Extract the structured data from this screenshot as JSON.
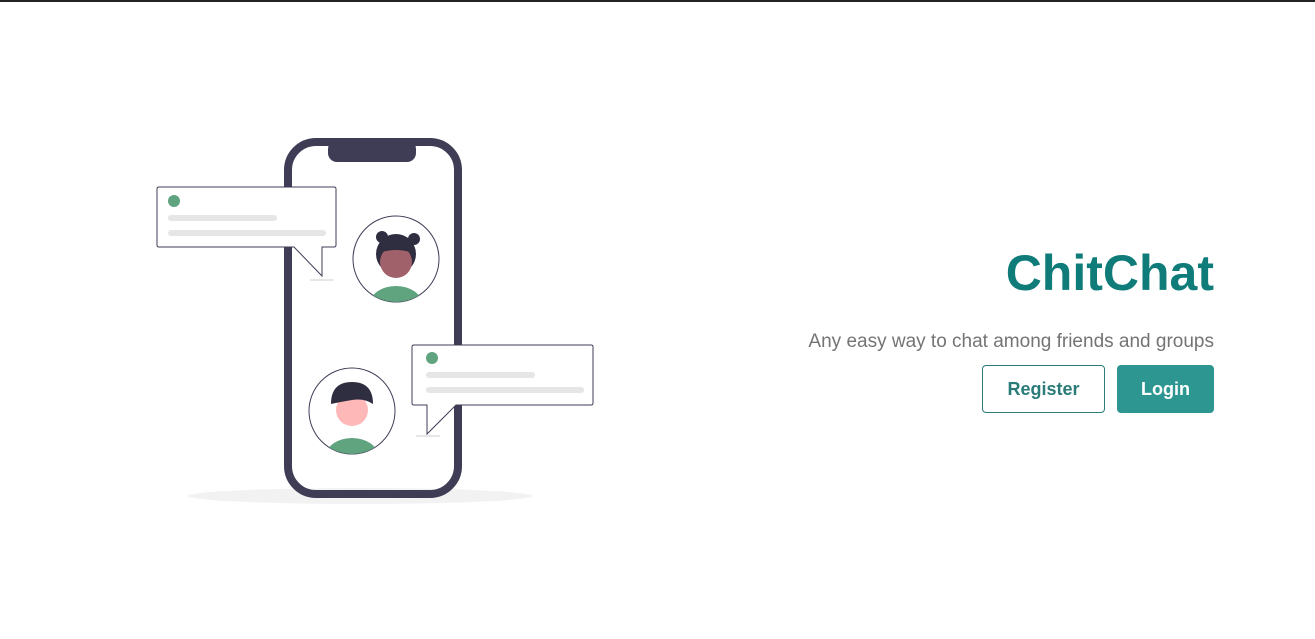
{
  "hero": {
    "title": "ChitChat",
    "tagline": "Any easy way to chat among friends and groups",
    "register_label": "Register",
    "login_label": "Login"
  },
  "illustration": {
    "subject": "phone-with-chat-bubbles",
    "colors": {
      "phone_frame": "#3f3d56",
      "accent_green": "#5fa37f",
      "placeholder_line": "#e6e6e6",
      "skin_dark": "#a0616a",
      "skin_light": "#ffb8b8",
      "hair": "#2f2e41",
      "shadow": "#f2f2f2"
    }
  },
  "theme": {
    "brand": "#0f7c7a",
    "button_primary_bg": "#2e9690",
    "button_outline_border": "#2a7c79",
    "text_muted": "#747474"
  }
}
